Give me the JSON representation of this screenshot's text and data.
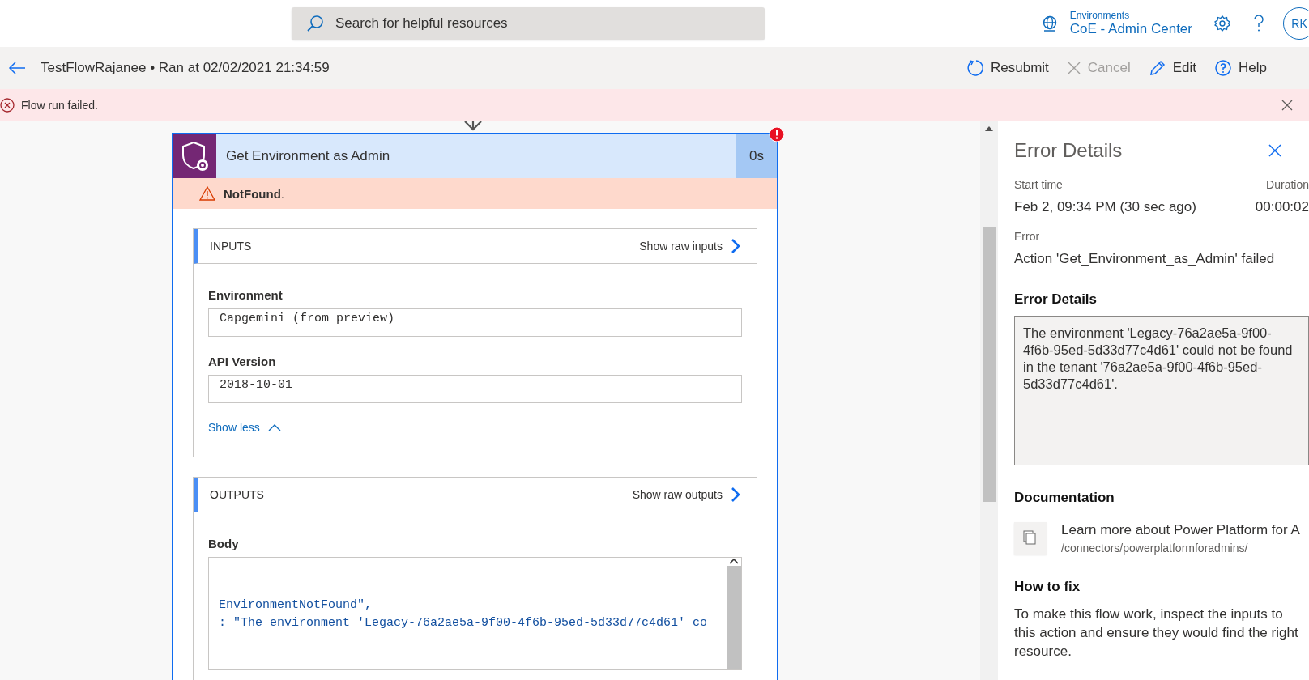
{
  "header": {
    "search": {
      "placeholder": "Search for helpful resources"
    },
    "environment": {
      "label": "Environments",
      "name": "CoE - Admin Center"
    },
    "avatar": "RK"
  },
  "command_bar": {
    "title": "TestFlowRajanee",
    "separator": "•",
    "run_info": "Ran at 02/02/2021 21:34:59",
    "actions": [
      {
        "kind": "resubmit",
        "label": "Resubmit",
        "disabled": false
      },
      {
        "kind": "cancel",
        "label": "Cancel",
        "disabled": true
      },
      {
        "kind": "edit",
        "label": "Edit",
        "disabled": false
      },
      {
        "kind": "help",
        "label": "Help",
        "disabled": false
      }
    ]
  },
  "banner": {
    "message": "Flow run failed."
  },
  "action_card": {
    "title": "Get Environment as Admin",
    "duration": "0s",
    "failed": true,
    "error": "NotFound",
    "error_suffix": ".",
    "inputs": {
      "heading": "INPUTS",
      "raw_link": "Show raw inputs",
      "fields": [
        {
          "label": "Environment",
          "value": "Capgemini (from preview)"
        },
        {
          "label": "API Version",
          "value": "2018-10-01"
        }
      ],
      "toggle": "Show less"
    },
    "outputs": {
      "heading": "OUTPUTS",
      "raw_link": "Show raw outputs",
      "body_label": "Body",
      "body_lines": [
        {
          "text": "EnvironmentNotFound\","
        },
        {
          "text": ": \"The environment 'Legacy-76a2ae5a-9f00-4f6b-95ed-5d33d77c4d61' co"
        }
      ]
    }
  },
  "error_panel": {
    "title": "Error Details",
    "start_time_label": "Start time",
    "start_time": "Feb 2, 09:34 PM (30 sec ago)",
    "duration_label": "Duration",
    "duration": "00:00:02",
    "error_label": "Error",
    "error": "Action 'Get_Environment_as_Admin' failed",
    "details_heading": "Error Details",
    "details": "The environment 'Legacy-76a2ae5a-9f00-4f6b-95ed-5d33d77c4d61' could not be found in the tenant '76a2ae5a-9f00-4f6b-95ed-5d33d77c4d61'.",
    "documentation_heading": "Documentation",
    "doc_link": "Learn more about Power Platform for A",
    "doc_path": "/connectors/powerplatformforadmins/",
    "fix_heading": "How to fix",
    "fix_text": "To make this flow work, inspect the inputs to this action and ensure they would find the right resource."
  }
}
